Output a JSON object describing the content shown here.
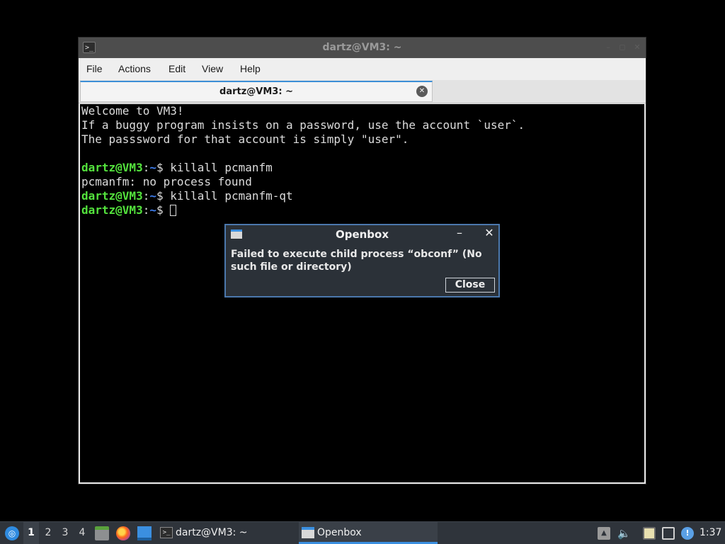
{
  "terminal_window": {
    "title": "dartz@VM3: ~",
    "title_icon": "terminal-icon",
    "buttons": {
      "minimize": "–",
      "maximize": "◻",
      "close": "✕"
    },
    "menu": [
      "File",
      "Actions",
      "Edit",
      "View",
      "Help"
    ],
    "tab": {
      "label": "dartz@VM3: ~",
      "close_glyph": "✕"
    },
    "lines": {
      "l0": "Welcome to VM3!",
      "l1": "If a buggy program insists on a password, use the account `user`.",
      "l2": "The passsword for that account is simply \"user\".",
      "l5": "pcmanfm: no process found"
    },
    "prompt": {
      "user": "dartz@VM3",
      "sep": ":",
      "path": "~",
      "symbol": "$ "
    },
    "commands": [
      "killall pcmanfm",
      "killall pcmanfm-qt",
      ""
    ],
    "colors": {
      "prompt_user": "#54e33d",
      "prompt_path": "#3f7ff0",
      "text": "#dcdcdc"
    }
  },
  "dialog": {
    "title": "Openbox",
    "minimize_glyph": "–",
    "close_glyph": "✕",
    "message": "Failed to execute child process “obconf” (No such file or directory)",
    "button_label": "Close",
    "border_color": "#4b78ad"
  },
  "taskbar": {
    "start_icon": "lxqt-logo-icon",
    "desktops": [
      "1",
      "2",
      "3",
      "4"
    ],
    "active_desktop": "1",
    "quicklaunch": [
      "file-manager-icon",
      "firefox-icon",
      "show-desktop-icon"
    ],
    "tasks": [
      {
        "label": "dartz@VM3: ~",
        "icon": "terminal-icon",
        "active": false
      },
      {
        "label": "Openbox",
        "icon": "window-icon",
        "active": true
      }
    ],
    "tray": [
      "eject-icon",
      "volume-icon",
      "clipboard-icon",
      "network-icon",
      "notification-icon"
    ],
    "clock": "1:37"
  }
}
